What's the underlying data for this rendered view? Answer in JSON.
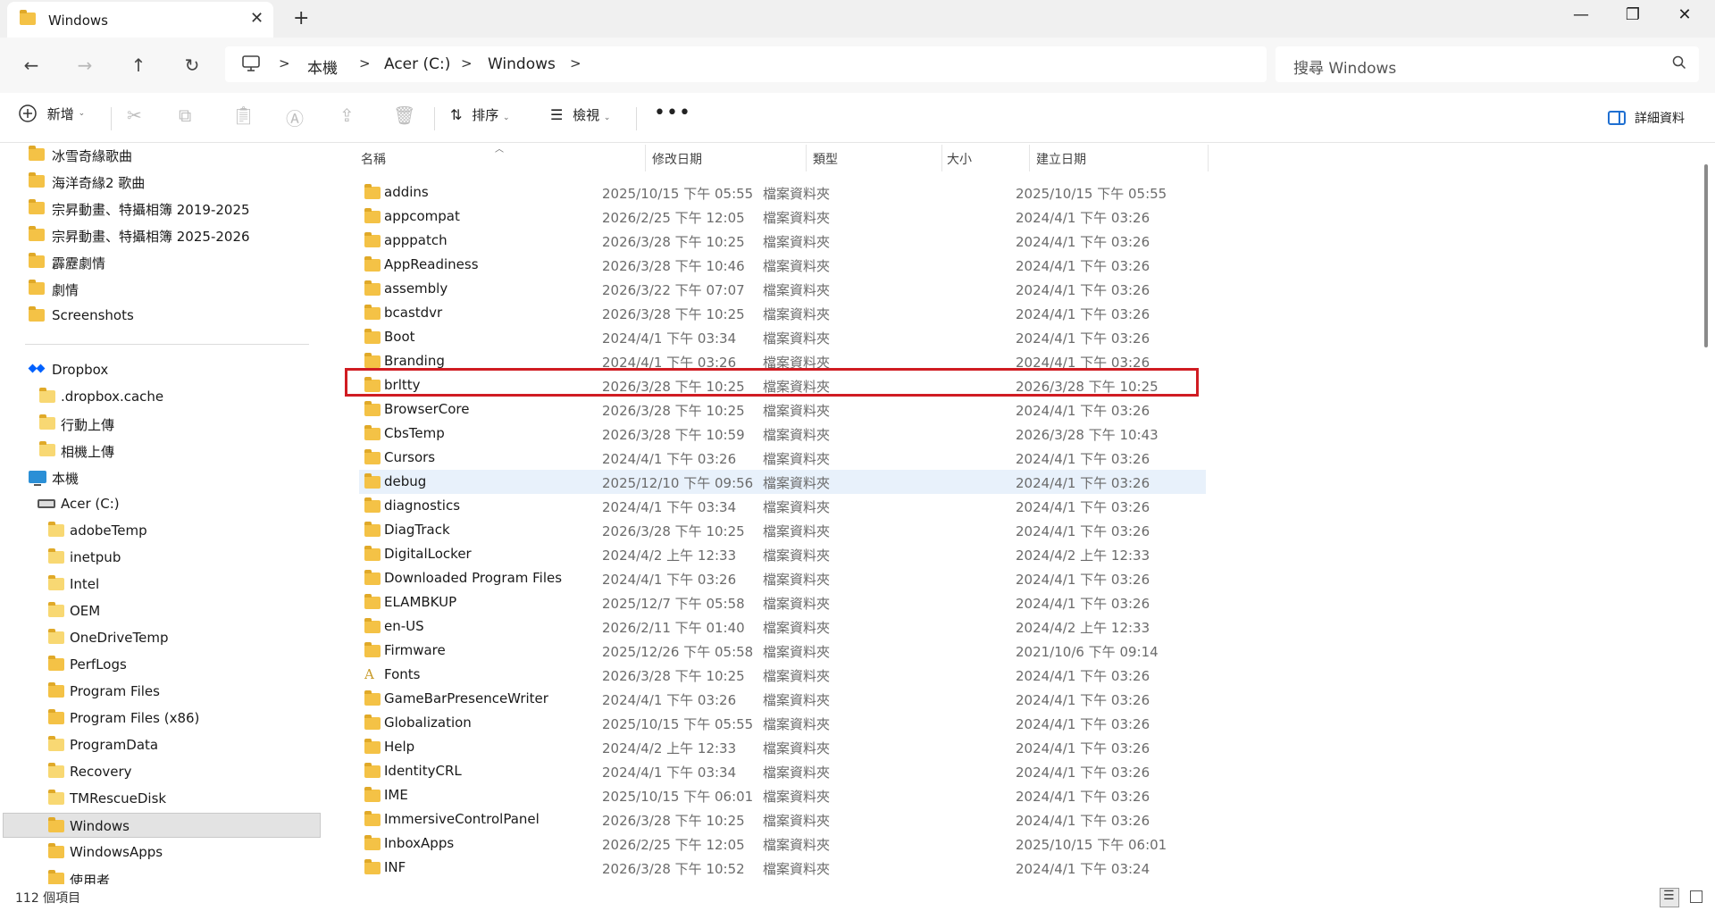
{
  "window": {
    "tab_title": "Windows",
    "new_tab_label": "+",
    "close_tab_label": "✕",
    "minimize_label": "—",
    "restore_label": "❐",
    "close_label": "✕"
  },
  "nav": {
    "back_label": "←",
    "forward_label": "→",
    "up_label": "↑",
    "refresh_label": "↻"
  },
  "address": {
    "crumbs": [
      "本機",
      "Acer (C:)",
      "Windows"
    ],
    "separator": ">"
  },
  "search": {
    "placeholder": "搜尋 Windows",
    "icon_label": "⌕"
  },
  "commands": {
    "new_label": "新增",
    "sort_label": "排序",
    "view_label": "檢視",
    "more_label": "•••",
    "details_label": "詳細資料"
  },
  "sidebar": {
    "pinned": [
      {
        "label": "冰雪奇緣歌曲"
      },
      {
        "label": "海洋奇緣2 歌曲"
      },
      {
        "label": "宗昇動畫、特攝相簿 2019-2025"
      },
      {
        "label": "宗昇動畫、特攝相簿 2025-2026"
      },
      {
        "label": "霹靂劇情"
      },
      {
        "label": "劇情"
      },
      {
        "label": "Screenshots"
      }
    ],
    "dropbox": {
      "label": "Dropbox",
      "children": [
        ".dropbox.cache",
        "行動上傳",
        "相機上傳"
      ]
    },
    "this_pc": {
      "label": "本機"
    },
    "drive": {
      "label": "Acer (C:)"
    },
    "drive_children": [
      "adobeTemp",
      "inetpub",
      "Intel",
      "OEM",
      "OneDriveTemp",
      "PerfLogs",
      "Program Files",
      "Program Files (x86)",
      "ProgramData",
      "Recovery",
      "TMRescueDisk",
      "Windows",
      "WindowsApps",
      "使用者"
    ]
  },
  "columns": {
    "name": "名稱",
    "modified": "修改日期",
    "type": "類型",
    "size": "大小",
    "created": "建立日期"
  },
  "files": [
    {
      "name": "addins",
      "modified": "2025/10/15 下午 05:55",
      "type": "檔案資料夾",
      "created": "2025/10/15 下午 05:55"
    },
    {
      "name": "appcompat",
      "modified": "2026/2/25 下午 12:05",
      "type": "檔案資料夾",
      "created": "2024/4/1 下午 03:26"
    },
    {
      "name": "apppatch",
      "modified": "2026/3/28 下午 10:25",
      "type": "檔案資料夾",
      "created": "2024/4/1 下午 03:26"
    },
    {
      "name": "AppReadiness",
      "modified": "2026/3/28 下午 10:46",
      "type": "檔案資料夾",
      "created": "2024/4/1 下午 03:26"
    },
    {
      "name": "assembly",
      "modified": "2026/3/22 下午 07:07",
      "type": "檔案資料夾",
      "created": "2024/4/1 下午 03:26"
    },
    {
      "name": "bcastdvr",
      "modified": "2026/3/28 下午 10:25",
      "type": "檔案資料夾",
      "created": "2024/4/1 下午 03:26"
    },
    {
      "name": "Boot",
      "modified": "2024/4/1 下午 03:34",
      "type": "檔案資料夾",
      "created": "2024/4/1 下午 03:26"
    },
    {
      "name": "Branding",
      "modified": "2024/4/1 下午 03:26",
      "type": "檔案資料夾",
      "created": "2024/4/1 下午 03:26"
    },
    {
      "name": "brltty",
      "modified": "2026/3/28 下午 10:25",
      "type": "檔案資料夾",
      "created": "2026/3/28 下午 10:25"
    },
    {
      "name": "BrowserCore",
      "modified": "2026/3/28 下午 10:25",
      "type": "檔案資料夾",
      "created": "2024/4/1 下午 03:26"
    },
    {
      "name": "CbsTemp",
      "modified": "2026/3/28 下午 10:59",
      "type": "檔案資料夾",
      "created": "2026/3/28 下午 10:43"
    },
    {
      "name": "Cursors",
      "modified": "2024/4/1 下午 03:26",
      "type": "檔案資料夾",
      "created": "2024/4/1 下午 03:26"
    },
    {
      "name": "debug",
      "modified": "2025/12/10 下午 09:56",
      "type": "檔案資料夾",
      "created": "2024/4/1 下午 03:26"
    },
    {
      "name": "diagnostics",
      "modified": "2024/4/1 下午 03:34",
      "type": "檔案資料夾",
      "created": "2024/4/1 下午 03:26"
    },
    {
      "name": "DiagTrack",
      "modified": "2026/3/28 下午 10:25",
      "type": "檔案資料夾",
      "created": "2024/4/1 下午 03:26"
    },
    {
      "name": "DigitalLocker",
      "modified": "2024/4/2 上午 12:33",
      "type": "檔案資料夾",
      "created": "2024/4/2 上午 12:33"
    },
    {
      "name": "Downloaded Program Files",
      "modified": "2024/4/1 下午 03:26",
      "type": "檔案資料夾",
      "created": "2024/4/1 下午 03:26"
    },
    {
      "name": "ELAMBKUP",
      "modified": "2025/12/7 下午 05:58",
      "type": "檔案資料夾",
      "created": "2024/4/1 下午 03:26"
    },
    {
      "name": "en-US",
      "modified": "2026/2/11 下午 01:40",
      "type": "檔案資料夾",
      "created": "2024/4/2 上午 12:33"
    },
    {
      "name": "Firmware",
      "modified": "2025/12/26 下午 05:58",
      "type": "檔案資料夾",
      "created": "2021/10/6 下午 09:14"
    },
    {
      "name": "Fonts",
      "modified": "2026/3/28 下午 10:25",
      "type": "檔案資料夾",
      "created": "2024/4/1 下午 03:26"
    },
    {
      "name": "GameBarPresenceWriter",
      "modified": "2024/4/1 下午 03:26",
      "type": "檔案資料夾",
      "created": "2024/4/1 下午 03:26"
    },
    {
      "name": "Globalization",
      "modified": "2025/10/15 下午 05:55",
      "type": "檔案資料夾",
      "created": "2024/4/1 下午 03:26"
    },
    {
      "name": "Help",
      "modified": "2024/4/2 上午 12:33",
      "type": "檔案資料夾",
      "created": "2024/4/1 下午 03:26"
    },
    {
      "name": "IdentityCRL",
      "modified": "2024/4/1 下午 03:34",
      "type": "檔案資料夾",
      "created": "2024/4/1 下午 03:26"
    },
    {
      "name": "IME",
      "modified": "2025/10/15 下午 06:01",
      "type": "檔案資料夾",
      "created": "2024/4/1 下午 03:26"
    },
    {
      "name": "ImmersiveControlPanel",
      "modified": "2026/3/28 下午 10:25",
      "type": "檔案資料夾",
      "created": "2024/4/1 下午 03:26"
    },
    {
      "name": "InboxApps",
      "modified": "2026/2/25 下午 12:05",
      "type": "檔案資料夾",
      "created": "2025/10/15 下午 06:01"
    },
    {
      "name": "INF",
      "modified": "2026/3/28 下午 10:52",
      "type": "檔案資料夾",
      "created": "2024/4/1 下午 03:24"
    }
  ],
  "status": {
    "item_count": "112 個項目"
  },
  "colors": {
    "highlight_box": "#d01c22",
    "hover_row": "#e8f1fb",
    "folder": "#f4c246"
  }
}
